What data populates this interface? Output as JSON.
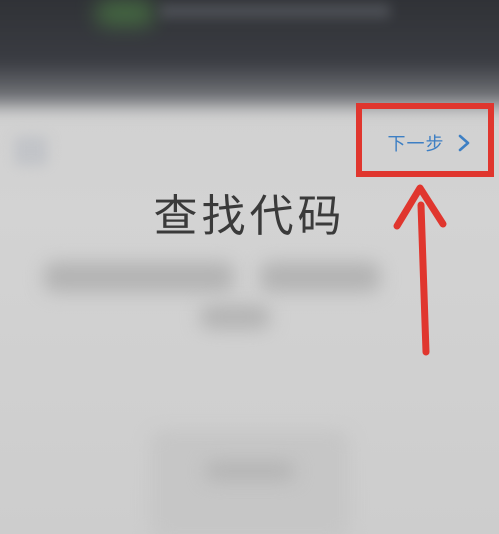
{
  "header": {
    "next_label": "下一步",
    "next_icon": "chevron-right-icon"
  },
  "main": {
    "title": "查找代码"
  },
  "annotations": {
    "highlight_color": "#e0362e",
    "arrow_color": "#e0362e"
  },
  "colors": {
    "accent": "#3d7fc4",
    "background": "#d0d0d0",
    "status_bar": "#2d2f33"
  }
}
